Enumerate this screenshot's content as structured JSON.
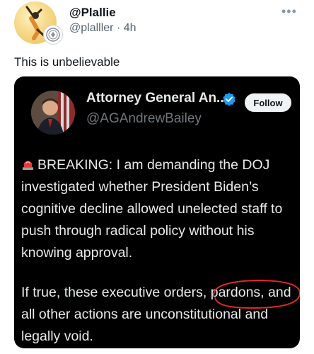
{
  "post": {
    "display_name": "@Plallie",
    "handle": "@plalller",
    "time": "4h",
    "separator": "·",
    "more_icon": "•••",
    "text": "This is unbelievable"
  },
  "quoted": {
    "name": "Attorney General An...",
    "handle": "@AGAndrewBailey",
    "follow_label": "Follow",
    "para1_text": "BREAKING: I am demanding the DOJ investigated whether President Biden’s cognitive decline allowed unelected staff to push through radical policy without his knowing approval.",
    "para2_before": "If true, these executive orders, ",
    "para2_circled": "pardons,",
    "para2_after": " and all other actions are unconstitutional and legally void."
  },
  "colors": {
    "card_bg": "#000000",
    "verified_blue": "#1d9bf0",
    "annotation_red": "#e0262b",
    "siren_red": "#e53935"
  },
  "icons": {
    "siren": "police-car-light-emoji",
    "verified": "verified-badge-icon",
    "badge": "seal-badge-icon",
    "more": "more-options-icon"
  }
}
